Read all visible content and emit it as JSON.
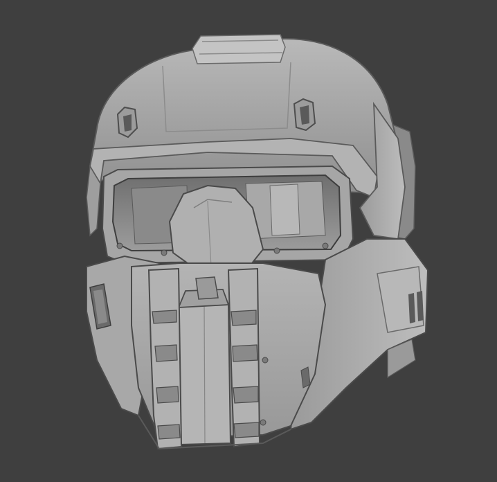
{
  "viewport": {
    "background": "#3f3f3f",
    "subject": "sculpted-helmet-model"
  },
  "model": {
    "material_light": "#cfcfcf",
    "material_mid": "#a9a9a9",
    "material_dark": "#7a7a7a",
    "material_shadow": "#4a4a4a",
    "visor_interior": "#8e8e8e",
    "edge_highlight": "#e6e6e6"
  }
}
